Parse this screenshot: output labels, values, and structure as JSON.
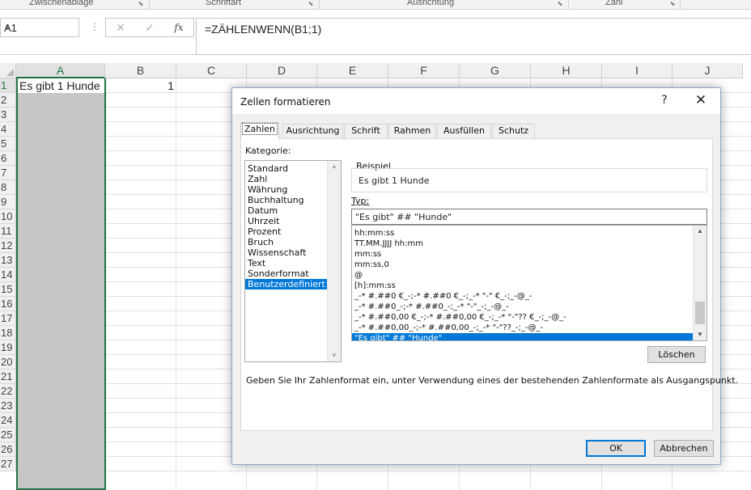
{
  "ribbon": {
    "groups": [
      "Zwischenablage",
      "Schriftart",
      "Ausrichtung",
      "Zahl"
    ]
  },
  "formula_bar": {
    "name_box": "A1",
    "cancel_glyph": "✕",
    "enter_glyph": "✓",
    "fx_glyph": "fx",
    "formula": "=ZÄHLENWENN(B1;1)"
  },
  "sheet": {
    "columns": [
      "A",
      "B",
      "C",
      "D",
      "E",
      "F",
      "G",
      "H",
      "I",
      "J"
    ],
    "rows": [
      "1",
      "2",
      "3",
      "4",
      "5",
      "6",
      "7",
      "8",
      "9",
      "10",
      "11",
      "12",
      "13",
      "14",
      "15",
      "16",
      "17",
      "18",
      "19",
      "20",
      "21",
      "22",
      "23",
      "24",
      "25",
      "26",
      "27"
    ],
    "cell_a1": "Es gibt 1 Hunde",
    "cell_b1": "1"
  },
  "dialog": {
    "title": "Zellen formatieren",
    "help": "?",
    "close": "✕",
    "tabs": [
      "Zahlen",
      "Ausrichtung",
      "Schrift",
      "Rahmen",
      "Ausfüllen",
      "Schutz"
    ],
    "active_tab": "Zahlen",
    "kategorie_label": "Kategorie:",
    "categories": [
      "Standard",
      "Zahl",
      "Währung",
      "Buchhaltung",
      "Datum",
      "Uhrzeit",
      "Prozent",
      "Bruch",
      "Wissenschaft",
      "Text",
      "Sonderformat",
      "Benutzerdefiniert"
    ],
    "selected_category": "Benutzerdefiniert",
    "beispiel_label": "Beispiel",
    "beispiel_value": "Es gibt 1 Hunde",
    "typ_label": "Typ:",
    "typ_value": "\"Es gibt\" ## \"Hunde\"",
    "formats": [
      "hh:mm:ss",
      "TT.MM.JJJJ hh:mm",
      "mm:ss",
      "mm:ss,0",
      "@",
      "[h]:mm:ss",
      "_-* #.##0 €_-;-* #.##0 €_-;_-* \"-\" €_-;_-@_-",
      "_-* #.##0_-;-* #.##0_-;_-* \"-\"_-;_-@_-",
      "_-* #.##0,00 €_-;-* #.##0,00 €_-;_-* \"-\"?? €_-;_-@_-",
      "_-* #.##0,00_-;-* #.##0,00_-;_-* \"-\"??_-;_-@_-",
      "\"Es gibt\" ## \"Hunde\""
    ],
    "selected_format": "\"Es gibt\" ## \"Hunde\"",
    "loeschen_label": "Löschen",
    "hint": "Geben Sie Ihr Zahlenformat ein, unter Verwendung eines der bestehenden Zahlenformate als Ausgangspunkt.",
    "ok_label": "OK",
    "cancel_label": "Abbrechen"
  }
}
